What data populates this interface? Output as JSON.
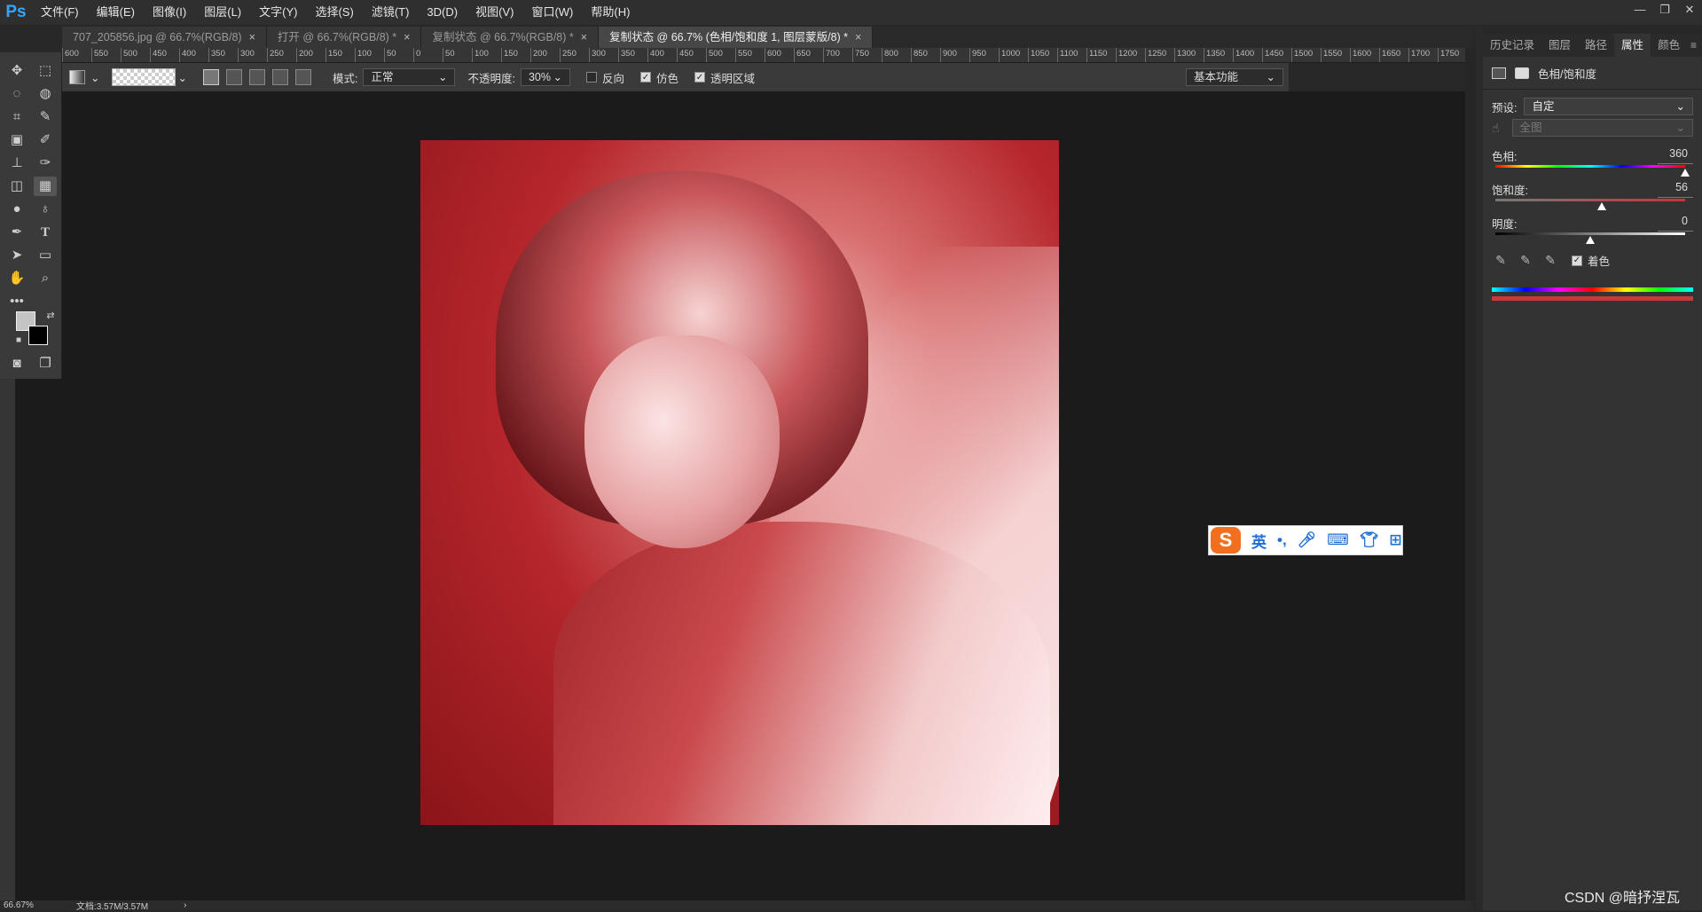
{
  "app": {
    "logo": "Ps",
    "menu": [
      "文件(F)",
      "编辑(E)",
      "图像(I)",
      "图层(L)",
      "文字(Y)",
      "选择(S)",
      "滤镜(T)",
      "3D(D)",
      "视图(V)",
      "窗口(W)",
      "帮助(H)"
    ],
    "window_controls": [
      "—",
      "❐",
      "✕"
    ]
  },
  "tabs": [
    {
      "label": "707_205856.jpg @ 66.7%(RGB/8)",
      "close": "×"
    },
    {
      "label": "打开 @ 66.7%(RGB/8) *",
      "close": "×"
    },
    {
      "label": "复制状态 @ 66.7%(RGB/8) *",
      "close": "×"
    },
    {
      "label": "复制状态 @ 66.7% (色相/饱和度 1, 图层蒙版/8) *",
      "close": "×"
    }
  ],
  "ruler_top": [
    "600",
    "550",
    "500",
    "450",
    "400",
    "350",
    "300",
    "250",
    "200",
    "150",
    "100",
    "50",
    "0",
    "50",
    "100",
    "150",
    "200",
    "250",
    "300",
    "350",
    "400",
    "450",
    "500",
    "550",
    "600",
    "650",
    "700",
    "750",
    "800",
    "850",
    "900",
    "950",
    "1000",
    "1050",
    "1100",
    "1150",
    "1200",
    "1250",
    "1300",
    "1350",
    "1400",
    "1450",
    "1500",
    "1550",
    "1600",
    "1650",
    "1700",
    "1750"
  ],
  "options": {
    "mode_label": "模式:",
    "mode_value": "正常",
    "opacity_label": "不透明度:",
    "opacity_value": "30%",
    "reverse_label": "反向",
    "dither_label": "仿色",
    "transparency_label": "透明区域",
    "workspace": "基本功能"
  },
  "ime": {
    "logo": "S",
    "lang": "英",
    "punct": "•,"
  },
  "status": {
    "zoom": "66.67%",
    "doc": "文档:3.57M/3.57M",
    "arrow": "›"
  },
  "panel": {
    "tabs": [
      "历史记录",
      "图层",
      "路径",
      "属性",
      "颜色"
    ],
    "title": "色相/饱和度",
    "preset_label": "预设:",
    "preset_value": "自定",
    "channel_value": "全图",
    "hue_label": "色相:",
    "hue_value": "360",
    "saturation_label": "饱和度:",
    "saturation_value": "56",
    "lightness_label": "明度:",
    "lightness_value": "0",
    "colorize_label": "着色",
    "hue": 360,
    "saturation": 56,
    "lightness": 0
  },
  "watermark": "CSDN @暗抒涅瓦"
}
